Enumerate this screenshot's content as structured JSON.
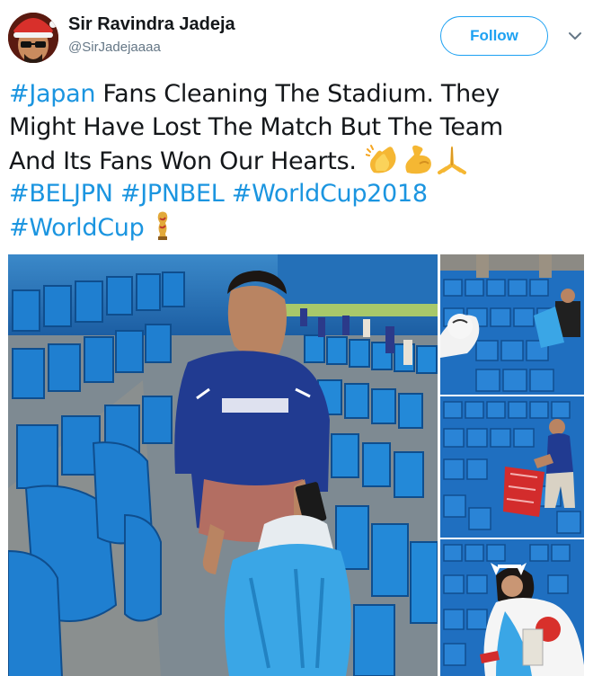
{
  "user": {
    "name": "Sir Ravindra Jadeja",
    "handle": "@SirJadejaaaa",
    "avatar": "avatar-photo"
  },
  "header": {
    "follow_label": "Follow",
    "menu_icon": "chevron-down-icon"
  },
  "tweet": {
    "hashtag_japan": "#Japan",
    "line1_rest": " Fans Cleaning The Stadium. They",
    "line2": "Might Have Lost The Match But The Team",
    "line3": "And Its Fans Won Our Hearts.",
    "emojis": [
      "clapping-hands-icon",
      "flexed-biceps-icon",
      "folded-hands-icon"
    ],
    "hashtags_line4": [
      "#BELJPN",
      "#JPNBEL",
      "#WorldCup2018"
    ],
    "hashtag_worldcup": "#WorldCup",
    "trophy_icon": "world-cup-trophy-icon"
  },
  "media": {
    "photos": [
      "fan-picking-up-trash-photo",
      "fan-with-mascot-photo",
      "fan-with-red-bag-photo",
      "fan-with-flag-photo"
    ]
  },
  "colors": {
    "link": "#1b95e0",
    "follow": "#1da1f2",
    "text": "#14171a",
    "secondary": "#657786",
    "seat_blue": "#1f7fd0"
  }
}
